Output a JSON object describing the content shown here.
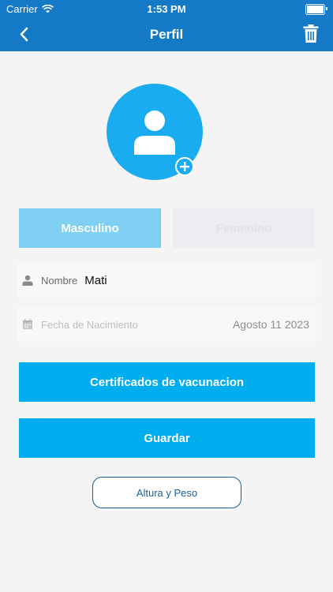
{
  "status_bar": {
    "carrier": "Carrier",
    "time": "1:53 PM",
    "icons": [
      "wifi-icon",
      "battery-icon"
    ]
  },
  "header": {
    "title": "Perfil",
    "icons": [
      "chevron-left-icon",
      "trash-icon"
    ]
  },
  "avatar": {
    "icons": [
      "person-icon",
      "add-circle-icon"
    ]
  },
  "gender": {
    "male_label": "Masculino",
    "female_label": "Femenino",
    "selected": "Masculino"
  },
  "form": {
    "name_label": "Nombre",
    "name_value": "Mati",
    "birthdate_label": "Fecha de Nacimiento",
    "birthdate_value": "Agosto 11 2023"
  },
  "actions": {
    "certificates_label": "Certificados de vacunacion",
    "save_label": "Guardar",
    "height_weight_label": "Altura y Peso"
  },
  "colors": {
    "header_bg": "#1479c6",
    "primary": "#00adef",
    "avatar": "#1aacf0",
    "selected_gender": "#7fd0f3",
    "outline": "#1d5f96",
    "page_bg": "#f4f4f4"
  }
}
